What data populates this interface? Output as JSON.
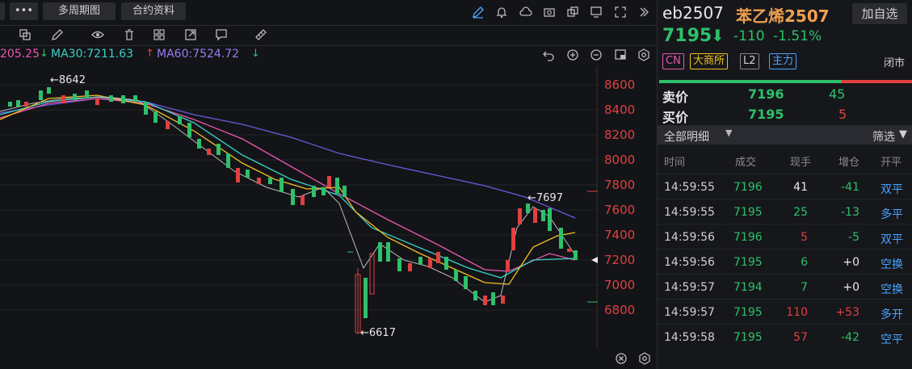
{
  "toolbar": {
    "more_label": "•••",
    "multi_period_label": "多周期图",
    "contract_info_label": "合约资料"
  },
  "ma_bar": {
    "ma_partial": "205.25",
    "ma30": "MA30:7211.63",
    "ma60": "MA60:7524.72"
  },
  "annotations": {
    "high": "←8642",
    "low": "←6617",
    "recent_high": "←7697"
  },
  "price_axis": [
    "8600",
    "8400",
    "8200",
    "8000",
    "7800",
    "7600",
    "7400",
    "7200",
    "7000",
    "6800"
  ],
  "symbol": {
    "code": "eb2507",
    "name": "苯乙烯2507",
    "price": "7195",
    "change": "-110",
    "change_pct": "-1.51%",
    "add_watch_label": "加自选",
    "status": "闭市",
    "badges": [
      "CN",
      "大商所",
      "L2",
      "主力"
    ]
  },
  "quotes": {
    "sell_label": "卖价",
    "sell_price": "7196",
    "sell_vol": "45",
    "buy_label": "买价",
    "buy_price": "7195",
    "buy_vol": "5"
  },
  "detail": {
    "all_label": "全部明细",
    "filter_label": "筛选",
    "headers": [
      "时间",
      "成交",
      "现手",
      "增仓",
      "开平"
    ],
    "rows": [
      {
        "time": "14:59:55",
        "price": "7196",
        "vol": "41",
        "oi": "-41",
        "type": "双平",
        "pc": "#2ec06a",
        "vc": "#e8e8ea",
        "oc": "#2ec06a",
        "tc": "#4aa3ff"
      },
      {
        "time": "14:59:55",
        "price": "7195",
        "vol": "25",
        "oi": "-13",
        "type": "多平",
        "pc": "#2ec06a",
        "vc": "#2ec06a",
        "oc": "#2ec06a",
        "tc": "#4aa3ff"
      },
      {
        "time": "14:59:56",
        "price": "7196",
        "vol": "5",
        "oi": "-5",
        "type": "双平",
        "pc": "#2ec06a",
        "vc": "#e04040",
        "oc": "#2ec06a",
        "tc": "#4aa3ff"
      },
      {
        "time": "14:59:56",
        "price": "7195",
        "vol": "6",
        "oi": "+0",
        "type": "空换",
        "pc": "#2ec06a",
        "vc": "#2ec06a",
        "oc": "#e8e8ea",
        "tc": "#4aa3ff"
      },
      {
        "time": "14:59:57",
        "price": "7194",
        "vol": "7",
        "oi": "+0",
        "type": "空换",
        "pc": "#2ec06a",
        "vc": "#2ec06a",
        "oc": "#e8e8ea",
        "tc": "#4aa3ff"
      },
      {
        "time": "14:59:57",
        "price": "7195",
        "vol": "110",
        "oi": "+53",
        "type": "多开",
        "pc": "#2ec06a",
        "vc": "#e04040",
        "oc": "#e04040",
        "tc": "#4aa3ff"
      },
      {
        "time": "14:59:58",
        "price": "7195",
        "vol": "57",
        "oi": "-42",
        "type": "空平",
        "pc": "#2ec06a",
        "vc": "#e04040",
        "oc": "#2ec06a",
        "tc": "#4aa3ff"
      }
    ]
  },
  "colors": {
    "up": "#e04040",
    "down": "#2ec06a",
    "accent": "#f0a050",
    "link": "#4aa3ff"
  }
}
